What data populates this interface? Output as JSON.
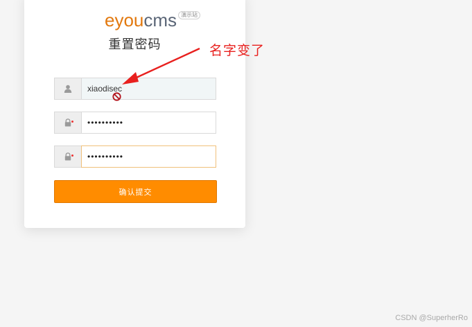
{
  "logo": {
    "brand_e": "eyou",
    "brand_c": "cms",
    "badge": "演示站"
  },
  "page_title": "重置密码",
  "form": {
    "username_value": "xiaodisec",
    "password_value": "••••••••••",
    "confirm_value": "••••••••••",
    "submit_label": "确认提交"
  },
  "annotation": {
    "text": "名字变了",
    "color": "#e8201e"
  },
  "colors": {
    "accent": "#ff8c00",
    "background": "#f5f5f5"
  },
  "icons": {
    "username": "user-icon",
    "password": "lock-icon",
    "confirm": "lock-icon",
    "cursor": "not-allowed-icon"
  },
  "watermark": "CSDN @SuperherRo"
}
